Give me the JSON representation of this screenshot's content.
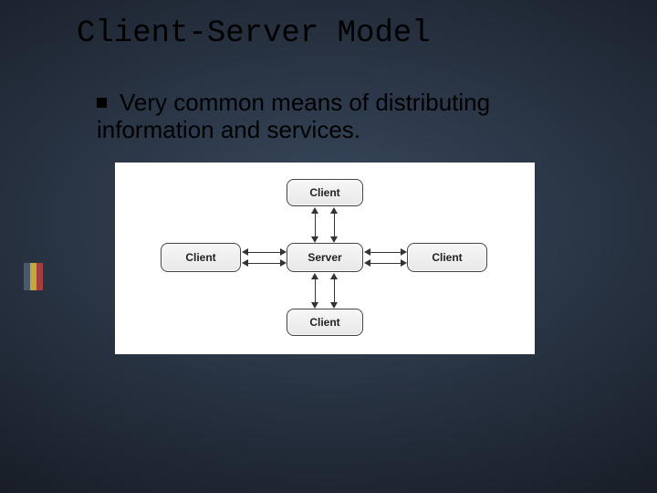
{
  "title": "Client-Server Model",
  "bullet": "Very common means of distributing information and services.",
  "diagram": {
    "server": "Server",
    "top": "Client",
    "bottom": "Client",
    "left": "Client",
    "right": "Client"
  },
  "accent": {
    "c1": "#4a5a6a",
    "c2": "#c2a83c",
    "c3": "#a63d3d"
  }
}
